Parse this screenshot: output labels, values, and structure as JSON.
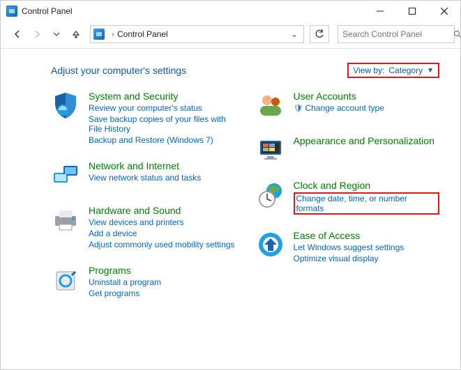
{
  "window": {
    "title": "Control Panel"
  },
  "address": {
    "crumb": "Control Panel"
  },
  "search": {
    "placeholder": "Search Control Panel"
  },
  "heading": "Adjust your computer's settings",
  "viewby": {
    "label": "View by:",
    "value": "Category"
  },
  "left": {
    "sys": {
      "title": "System and Security",
      "t1": "Review your computer's status",
      "t2": "Save backup copies of your files with File History",
      "t3": "Backup and Restore (Windows 7)"
    },
    "net": {
      "title": "Network and Internet",
      "t1": "View network status and tasks"
    },
    "hw": {
      "title": "Hardware and Sound",
      "t1": "View devices and printers",
      "t2": "Add a device",
      "t3": "Adjust commonly used mobility settings"
    },
    "prog": {
      "title": "Programs",
      "t1": "Uninstall a program",
      "t2": "Get programs"
    }
  },
  "right": {
    "users": {
      "title": "User Accounts",
      "t1": "Change account type"
    },
    "appear": {
      "title": "Appearance and Personalization"
    },
    "clock": {
      "title": "Clock and Region",
      "t1": "Change date, time, or number formats"
    },
    "ease": {
      "title": "Ease of Access",
      "t1": "Let Windows suggest settings",
      "t2": "Optimize visual display"
    }
  }
}
